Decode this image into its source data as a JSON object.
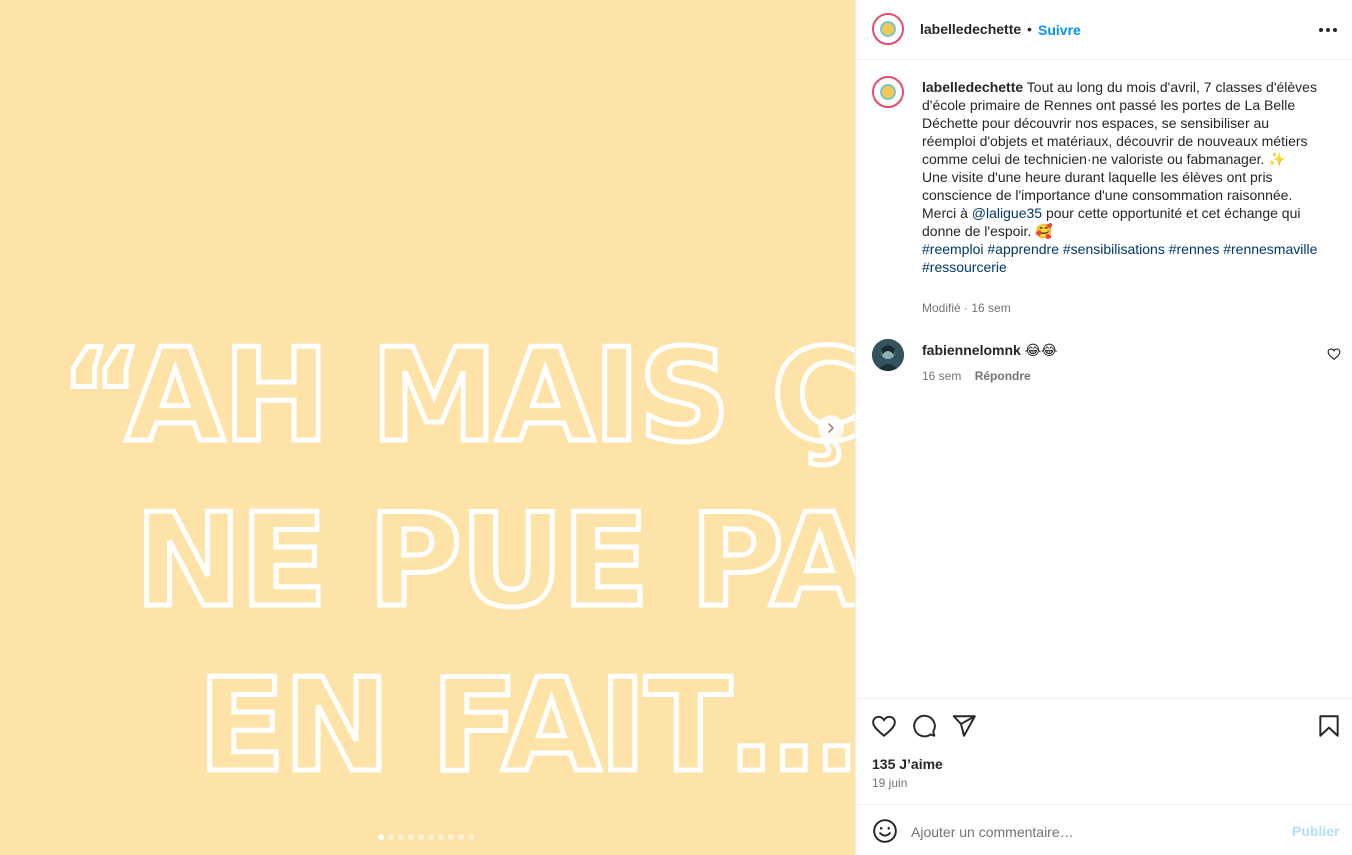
{
  "post": {
    "image_text": {
      "line1": "“AH MAIS ÇA",
      "line2": "NE PUE PAS",
      "line3": "EN FAIT…”"
    },
    "carousel": {
      "total": 10,
      "active": 1
    }
  },
  "header": {
    "username": "labelledechette",
    "separator": "•",
    "follow_label": "Suivre"
  },
  "caption": {
    "username": "labelledechette",
    "text_part1": "Tout au long du mois d'avril, 7 classes d'élèves d'école primaire de Rennes ont passé les portes de La Belle Déchette pour découvrir nos espaces, se sensibiliser au réemploi d'objets et matériaux, découvrir de nouveaux métiers comme celui de technicien·ne valoriste ou fabmanager. ✨",
    "text_part2": "Une visite d'une heure durant laquelle les élèves ont pris conscience de l'importance d'une consommation raisonnée.",
    "text_part3_before": "Merci à",
    "mention": "@laligue35",
    "text_part3_after": "pour cette opportunité et cet échange qui donne de l'espoir. 🥰",
    "hashtags": [
      "#reemploi",
      "#apprendre",
      "#sensibilisations",
      "#rennes",
      "#rennesmaville",
      "#ressourcerie"
    ],
    "edited_label": "Modifié",
    "time": "16 sem"
  },
  "comment": {
    "username": "fabiennelomnk",
    "text": "😂😂",
    "time": "16 sem",
    "reply_label": "Répondre"
  },
  "actions": {
    "likes": "135 J’aime",
    "date": "19 juin"
  },
  "add_comment": {
    "placeholder": "Ajouter un commentaire…",
    "publish_label": "Publier"
  },
  "colors": {
    "media_bg": "#fee3a8",
    "link_blue": "#0095f6",
    "logo_pink": "#e64a6e"
  }
}
